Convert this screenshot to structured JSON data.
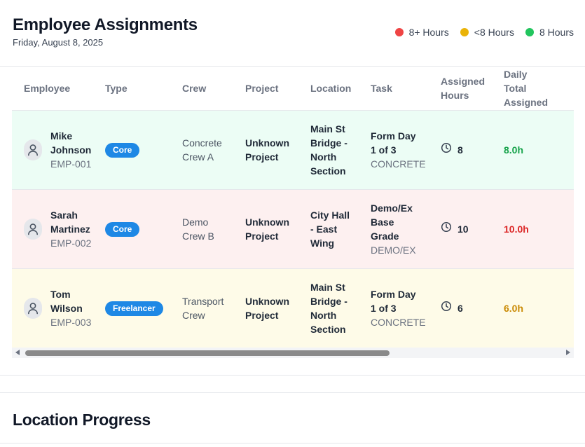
{
  "header": {
    "title": "Employee Assignments",
    "date": "Friday, August 8, 2025"
  },
  "legend": [
    {
      "label": "8+ Hours",
      "color": "#ef4444"
    },
    {
      "label": "<8 Hours",
      "color": "#eab308"
    },
    {
      "label": "8 Hours",
      "color": "#22c55e"
    }
  ],
  "table": {
    "columns": {
      "employee": "Employee",
      "type": "Type",
      "crew": "Crew",
      "project": "Project",
      "location": "Location",
      "task": "Task",
      "assigned_hours_1": "Assigned",
      "assigned_hours_2": "Hours",
      "daily_total_1": "Daily",
      "daily_total_2": "Total",
      "daily_total_3": "Assigned"
    },
    "rows": [
      {
        "status": "green",
        "name_first": "Mike",
        "name_last": "Johnson",
        "emp_id": "EMP-001",
        "type": "Core",
        "crew_1": "Concrete",
        "crew_2": "Crew A",
        "project_1": "Unknown",
        "project_2": "Project",
        "location_1": "Main St",
        "location_2": "Bridge -",
        "location_3": "North",
        "location_4": "Section",
        "task_1": "Form Day",
        "task_2": "1 of 3",
        "task_category": "CONCRETE",
        "assigned_hours": "8",
        "daily_total": "8.0h",
        "daily_color": "#16a34a"
      },
      {
        "status": "red",
        "name_first": "Sarah",
        "name_last": "Martinez",
        "emp_id": "EMP-002",
        "type": "Core",
        "crew_1": "Demo",
        "crew_2": "Crew B",
        "project_1": "Unknown",
        "project_2": "Project",
        "location_1": "City Hall",
        "location_2": "- East",
        "location_3": "Wing",
        "task_1": "Demo/Ex",
        "task_2": "Base",
        "task_3": "Grade",
        "task_category": "DEMO/EX",
        "assigned_hours": "10",
        "daily_total": "10.0h",
        "daily_color": "#dc2626"
      },
      {
        "status": "yellow",
        "name_first": "Tom",
        "name_last": "Wilson",
        "emp_id": "EMP-003",
        "type": "Freelancer",
        "crew_1": "Transport",
        "crew_2": "Crew",
        "project_1": "Unknown",
        "project_2": "Project",
        "location_1": "Main St",
        "location_2": "Bridge -",
        "location_3": "North",
        "location_4": "Section",
        "task_1": "Form Day",
        "task_2": "1 of 3",
        "task_category": "CONCRETE",
        "assigned_hours": "6",
        "daily_total": "6.0h",
        "daily_color": "#ca8a04"
      }
    ]
  },
  "sections": {
    "location_progress": "Location Progress"
  },
  "colors": {
    "badge": "#1e88e5",
    "row_green": "#ecfdf5",
    "row_red": "#fdf0f0",
    "row_yellow": "#fefbe8"
  }
}
